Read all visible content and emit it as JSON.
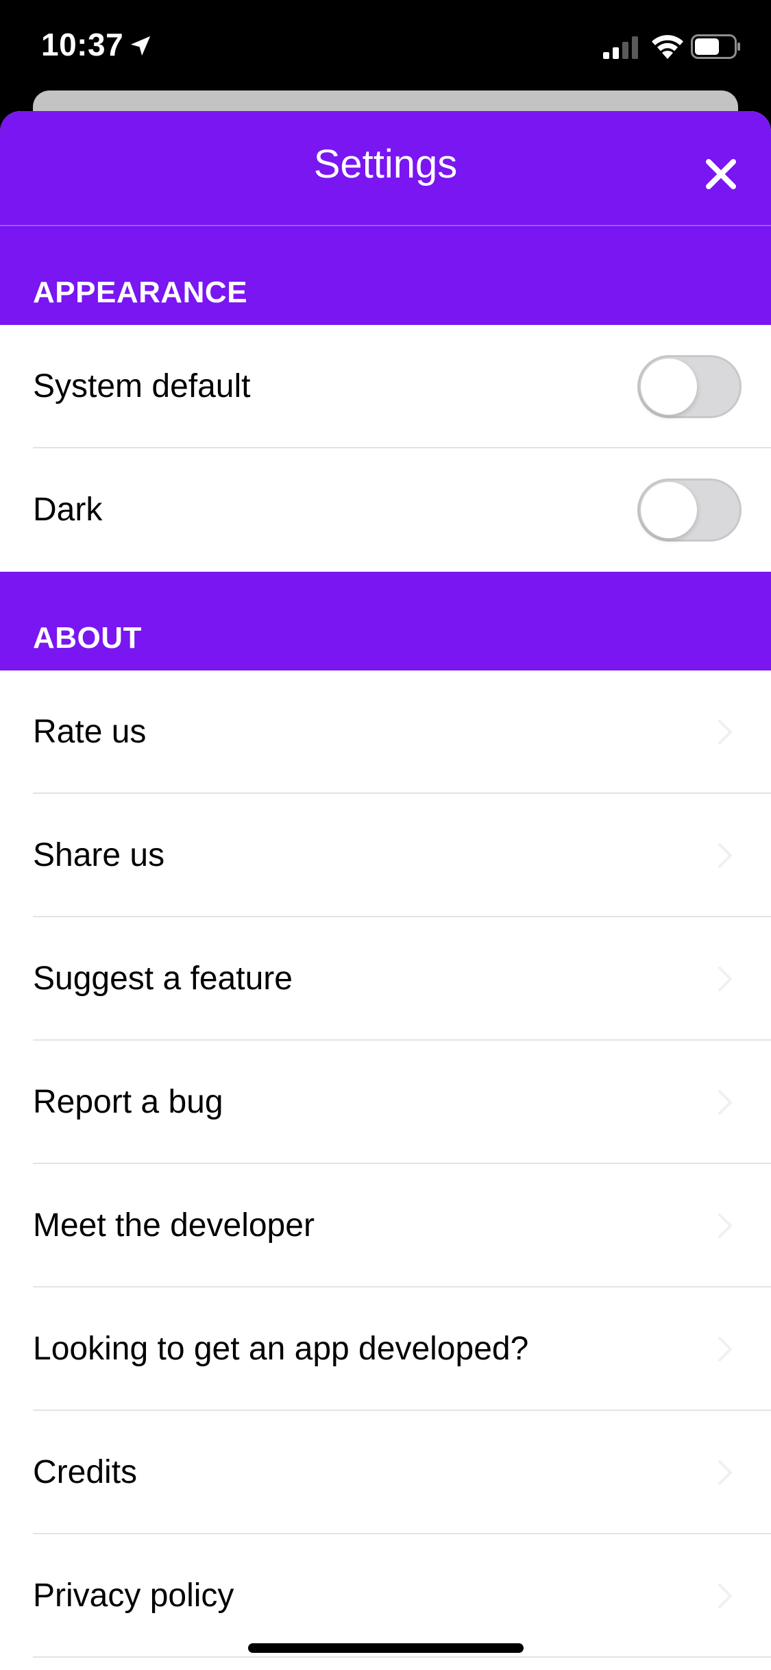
{
  "status_bar": {
    "time": "10:37"
  },
  "nav": {
    "title": "Settings",
    "close_icon": "close-icon"
  },
  "colors": {
    "accent": "#7916f2",
    "separator": "#e3e3e6",
    "toggle_off": "#d9d9dc"
  },
  "appearance": {
    "header": "APPEARANCE",
    "items": [
      {
        "label": "System default",
        "toggle_on": false
      },
      {
        "label": "Dark",
        "toggle_on": false
      }
    ]
  },
  "about": {
    "header": "ABOUT",
    "items": [
      {
        "label": "Rate us"
      },
      {
        "label": "Share us"
      },
      {
        "label": "Suggest a feature"
      },
      {
        "label": "Report a bug"
      },
      {
        "label": "Meet the developer"
      },
      {
        "label": "Looking to get an app developed?"
      },
      {
        "label": "Credits"
      },
      {
        "label": "Privacy policy"
      }
    ]
  }
}
